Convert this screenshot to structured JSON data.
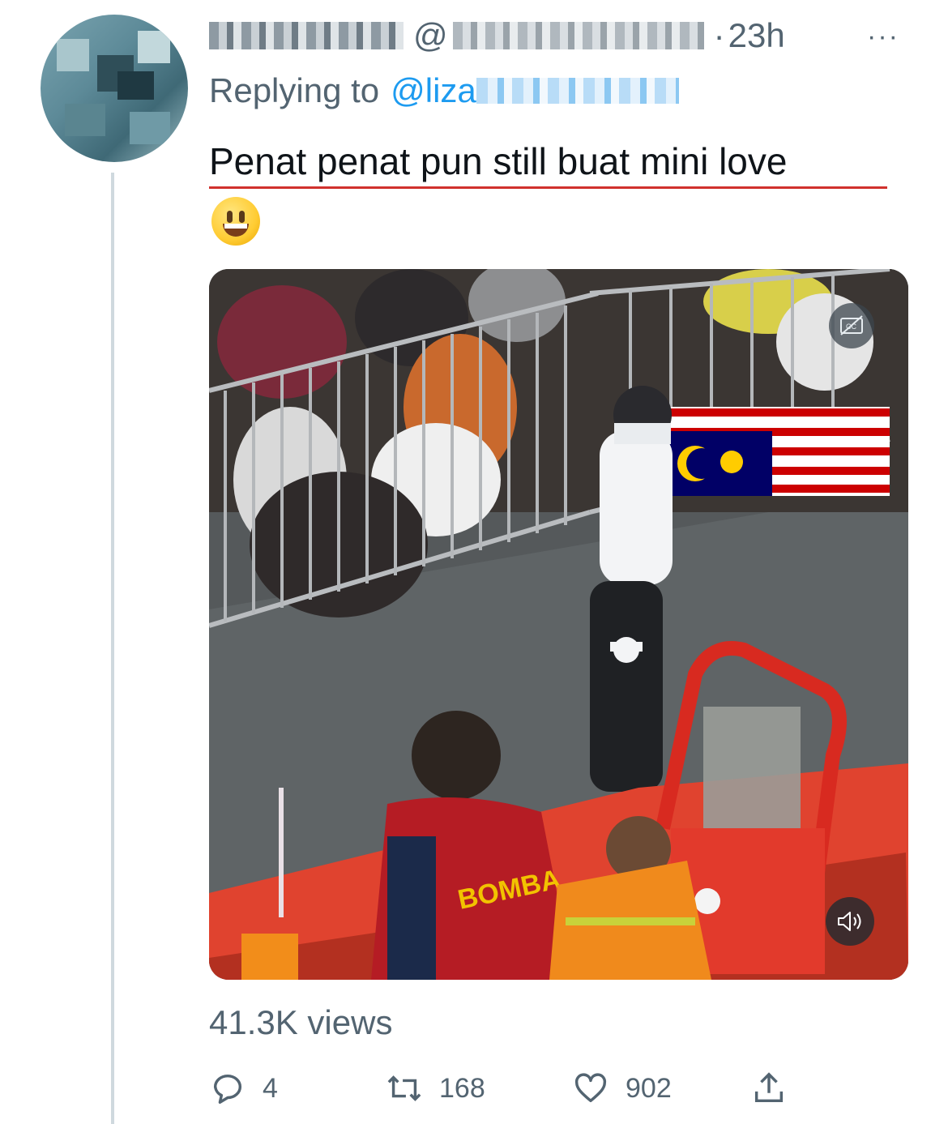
{
  "tweet": {
    "timestamp": "23h",
    "handle_prefix": "@",
    "dot": "·",
    "more": "···",
    "replying_prefix": "Replying to",
    "reply_mention_visible": "@liza",
    "text": "Penat penat pun still buat mini love",
    "emoji": "😃",
    "media": {
      "type": "video",
      "jersey_text": "BOMBA",
      "controls": [
        "captions-off-icon",
        "volume-icon"
      ]
    },
    "views": "41.3K views",
    "stats": {
      "replies": "4",
      "retweets": "168",
      "likes": "902"
    }
  },
  "colors": {
    "text_primary": "#0f1419",
    "text_secondary": "#536471",
    "mention_blue": "#1d9bf0",
    "thread_line": "#cfd9de",
    "spellcheck_red": "#d0312d"
  }
}
